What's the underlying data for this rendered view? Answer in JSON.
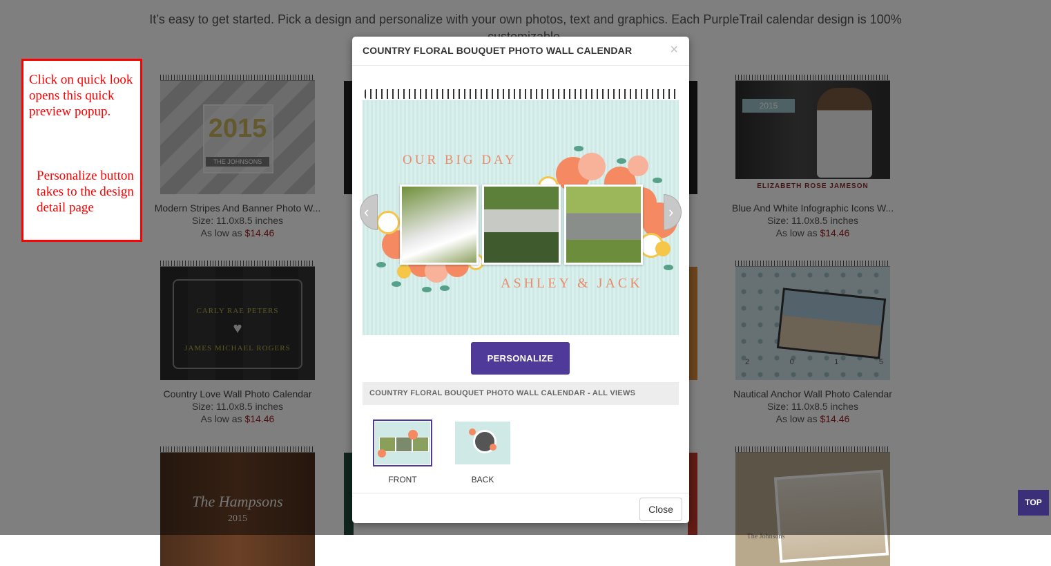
{
  "intro_text": "It’s easy to get started. Pick a design and personalize with your own photos, text and graphics. Each PurpleTrail calendar design is 100% customizable.",
  "products": [
    {
      "name": "Modern Stripes And Banner Photo W...",
      "size": "Size: 11.0x8.5 inches",
      "price_prefix": "As low as ",
      "price": "$14.46",
      "thumb_year": "2015",
      "thumb_banner": "THE JOHNSONS"
    },
    {
      "name": "Blue And White Infographic Icons W...",
      "size": "Size: 11.0x8.5 inches",
      "price_prefix": "As low as ",
      "price": "$14.46",
      "thumb_year": "2015",
      "thumb_label": "ELIZABETH ROSE JAMESON"
    },
    {
      "name": "Country Love Wall Photo Calendar",
      "size": "Size: 11.0x8.5 inches",
      "price_prefix": "As low as ",
      "price": "$14.46",
      "thumb_line1": "CARLY RAE PETERS",
      "thumb_line2": "JAMES MICHAEL ROGERS"
    },
    {
      "name": "Nautical Anchor Wall Photo Calendar",
      "size": "Size: 11.0x8.5 inches",
      "price_prefix": "As low as ",
      "price": "$14.46",
      "thumb_digits": [
        "2",
        "0",
        "1",
        "5"
      ]
    },
    {
      "thumb_title": "The Hampsons",
      "thumb_year": "2015"
    },
    {
      "thumb_label": "The Johnsons"
    }
  ],
  "annotation": {
    "line1": "Click on quick look opens this quick preview popup.",
    "line2": "Personalize button takes to the design detail page"
  },
  "modal": {
    "title": "COUNTRY FLORAL BOUQUET PHOTO WALL CALENDAR",
    "close_x": "×",
    "calendar_title": "OUR BIG DAY",
    "calendar_names": "ASHLEY & JACK",
    "prev_arrow": "‹",
    "next_arrow": "›",
    "personalize_label": "PERSONALIZE",
    "all_views_label": "COUNTRY FLORAL BOUQUET PHOTO WALL CALENDAR - ALL VIEWS",
    "views": [
      {
        "label": "FRONT",
        "selected": true
      },
      {
        "label": "BACK",
        "selected": false
      }
    ],
    "close_label": "Close"
  },
  "top_button": "TOP",
  "colors": {
    "accent": "#4f3a99",
    "price": "#a02020",
    "annotation": "#ff0000",
    "calendar_bg": "#cfeae6"
  }
}
